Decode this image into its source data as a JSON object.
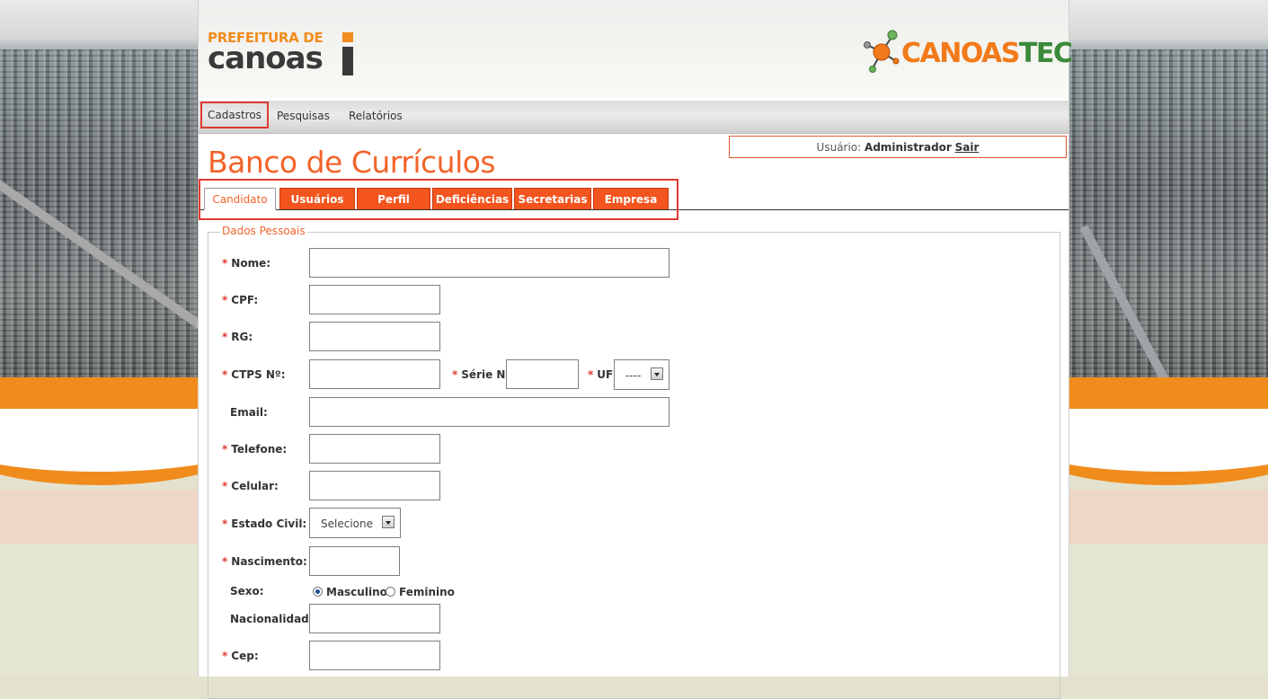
{
  "header": {
    "logo_left_top": "PREFEITURA DE",
    "logo_left_bottom": "canoas",
    "logo_right_a": "CANOAS",
    "logo_right_b": "TEC"
  },
  "menu": {
    "items": [
      {
        "label": "Cadastros"
      },
      {
        "label": "Pesquisas"
      },
      {
        "label": "Relatórios"
      }
    ]
  },
  "user": {
    "prefix": "Usuário:",
    "name": "Administrador",
    "logout": "Sair"
  },
  "page_title": "Banco de Currículos",
  "tabs": [
    {
      "label": "Candidato"
    },
    {
      "label": "Usuários"
    },
    {
      "label": "Perfil"
    },
    {
      "label": "Deficiências"
    },
    {
      "label": "Secretarias"
    },
    {
      "label": "Empresa"
    }
  ],
  "form": {
    "legend": "Dados Pessoais",
    "required_marker": "*",
    "fields": {
      "nome": "Nome:",
      "cpf": "CPF:",
      "rg": "RG:",
      "ctps": "CTPS Nº:",
      "serie": "Série Nº:",
      "uf": "UF:",
      "uf_value": "----",
      "email": "Email:",
      "telefone": "Telefone:",
      "celular": "Celular:",
      "estado_civil": "Estado Civil:",
      "estado_civil_value": "Selecione",
      "nascimento": "Nascimento:",
      "sexo": "Sexo:",
      "sexo_opt_m": "Masculino",
      "sexo_opt_f": "Feminino",
      "nacionalidade": "Nacionalidade:",
      "cep": "Cep:"
    }
  },
  "colors": {
    "accent": "#f2642a",
    "tab_bg": "#f4541e",
    "highlight": "#e03a32"
  }
}
